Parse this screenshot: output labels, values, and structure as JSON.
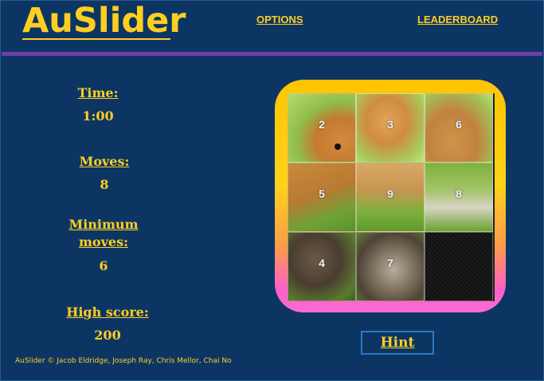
{
  "app": {
    "logo": "AuSlider"
  },
  "nav": {
    "options": "OPTIONS",
    "leaderboard": "LEADERBOARD"
  },
  "stats": {
    "time_label": "Time:",
    "time_value": "1:00",
    "moves_label": "Moves:",
    "moves_value": "8",
    "min_moves_label_1": "Minimum",
    "min_moves_label_2": "moves:",
    "min_moves_value": "6",
    "high_score_label": "High score:",
    "high_score_value": "200"
  },
  "board": {
    "tiles": [
      {
        "number": "2"
      },
      {
        "number": "3"
      },
      {
        "number": "6"
      },
      {
        "number": "5"
      },
      {
        "number": "9"
      },
      {
        "number": "8"
      },
      {
        "number": "4"
      },
      {
        "number": "7"
      },
      {
        "number": ""
      }
    ]
  },
  "hint_label": "Hint",
  "footer": "AuSlider © Jacob Eldridge, Joseph Ray, Chris Mellor, Chai No",
  "colors": {
    "background": "#0d3564",
    "accent": "#ffcf1f",
    "divider": "#6f3fa0",
    "hint_border": "#2d78c8"
  }
}
